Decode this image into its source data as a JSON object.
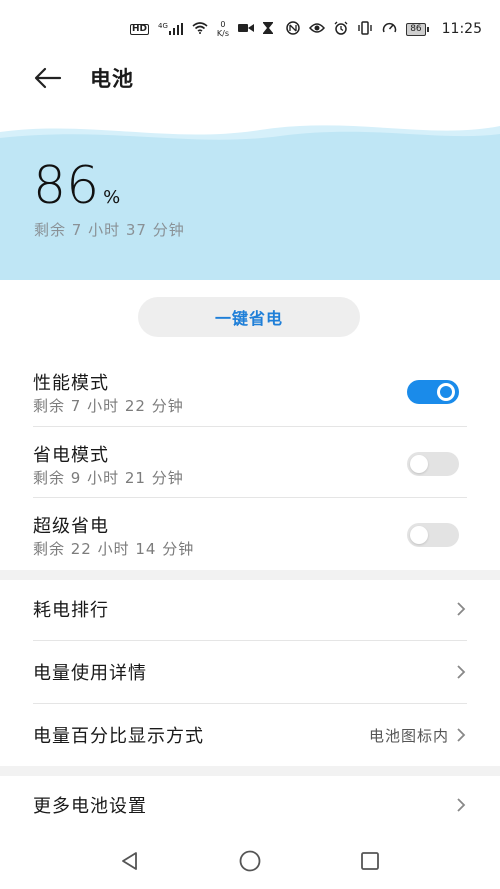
{
  "status_bar": {
    "hd": "HD",
    "network": "4G",
    "speed_value": "0",
    "speed_unit": "K/s",
    "battery_level": "86",
    "time": "11:25"
  },
  "header": {
    "title": "电池"
  },
  "battery": {
    "percent": "86",
    "percent_sign": "%",
    "remaining": "剩余 7 小时 37 分钟"
  },
  "one_key_button": {
    "label": "一键省电"
  },
  "modes": [
    {
      "title": "性能模式",
      "remaining": "剩余 7 小时 22 分钟",
      "enabled": true
    },
    {
      "title": "省电模式",
      "remaining": "剩余 9 小时 21 分钟",
      "enabled": false
    },
    {
      "title": "超级省电",
      "remaining": "剩余 22 小时 14 分钟",
      "enabled": false
    }
  ],
  "menu": {
    "consumption_ranking": "耗电排行",
    "usage_details": "电量使用详情",
    "percentage_display": "电量百分比显示方式",
    "percentage_display_value": "电池图标内",
    "more_settings": "更多电池设置"
  },
  "colors": {
    "accent": "#1a8bea",
    "hero_bg": "#bfe6f5"
  }
}
